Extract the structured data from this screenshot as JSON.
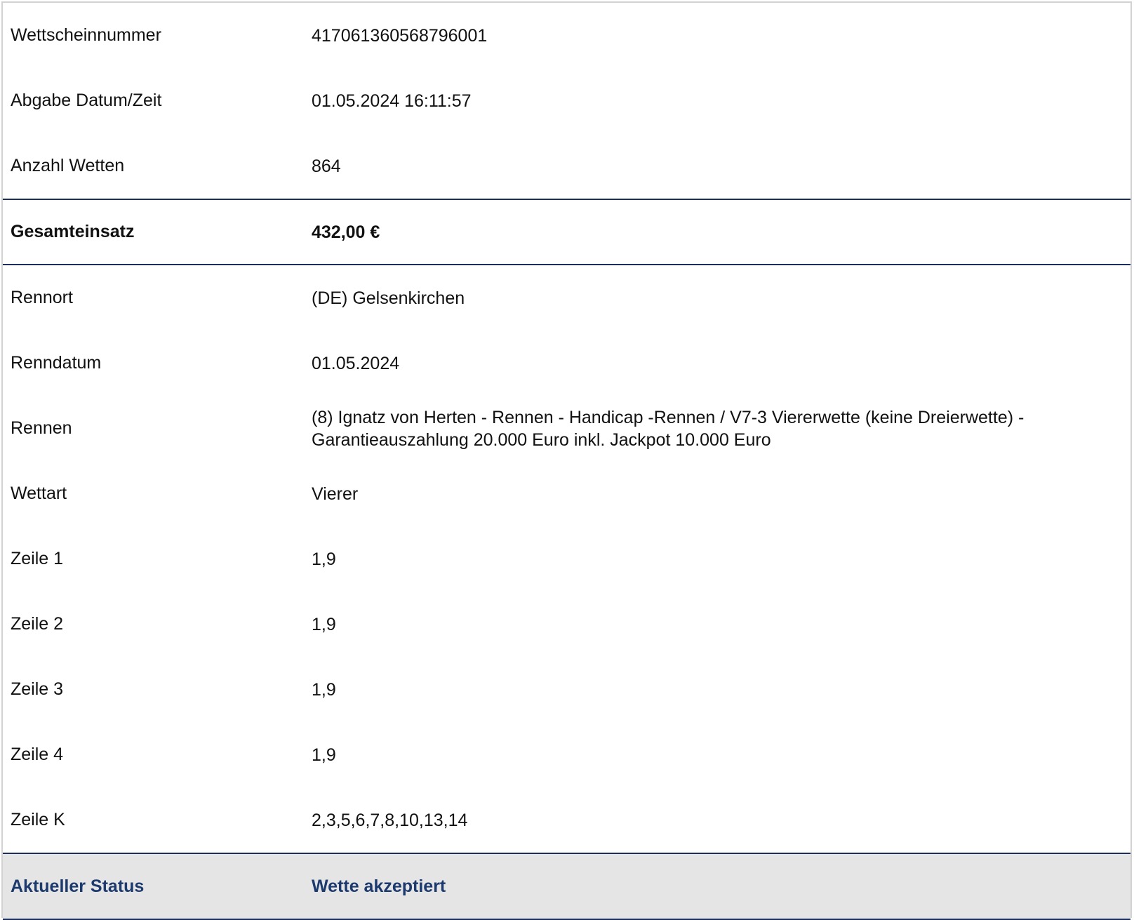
{
  "ticket": {
    "ticket_number": {
      "label": "Wettscheinnummer",
      "value": "417061360568796001"
    },
    "submitted_at": {
      "label": "Abgabe Datum/Zeit",
      "value": "01.05.2024 16:11:57"
    },
    "bet_count": {
      "label": "Anzahl Wetten",
      "value": "864"
    },
    "total_stake": {
      "label": "Gesamteinsatz",
      "value": "432,00 €"
    },
    "venue": {
      "label": "Rennort",
      "value": "(DE) Gelsenkirchen"
    },
    "race_date": {
      "label": "Renndatum",
      "value": "01.05.2024"
    },
    "race": {
      "label": "Rennen",
      "value": "(8) Ignatz von Herten - Rennen - Handicap -Rennen / V7-3 Viererwette (keine Dreierwette) - Garantieauszahlung 20.000 Euro inkl. Jackpot 10.000 Euro"
    },
    "bet_type": {
      "label": "Wettart",
      "value": "Vierer"
    },
    "line_1": {
      "label": "Zeile 1",
      "value": "1,9"
    },
    "line_2": {
      "label": "Zeile 2",
      "value": "1,9"
    },
    "line_3": {
      "label": "Zeile 3",
      "value": "1,9"
    },
    "line_4": {
      "label": "Zeile 4",
      "value": "1,9"
    },
    "line_k": {
      "label": "Zeile K",
      "value": "2,3,5,6,7,8,10,13,14"
    },
    "status": {
      "label": "Aktueller Status",
      "value": "Wette akzeptiert"
    }
  },
  "colors": {
    "accent": "#1c2e5e",
    "status_text": "#1c3a6e",
    "status_background": "#e5e5e5"
  }
}
